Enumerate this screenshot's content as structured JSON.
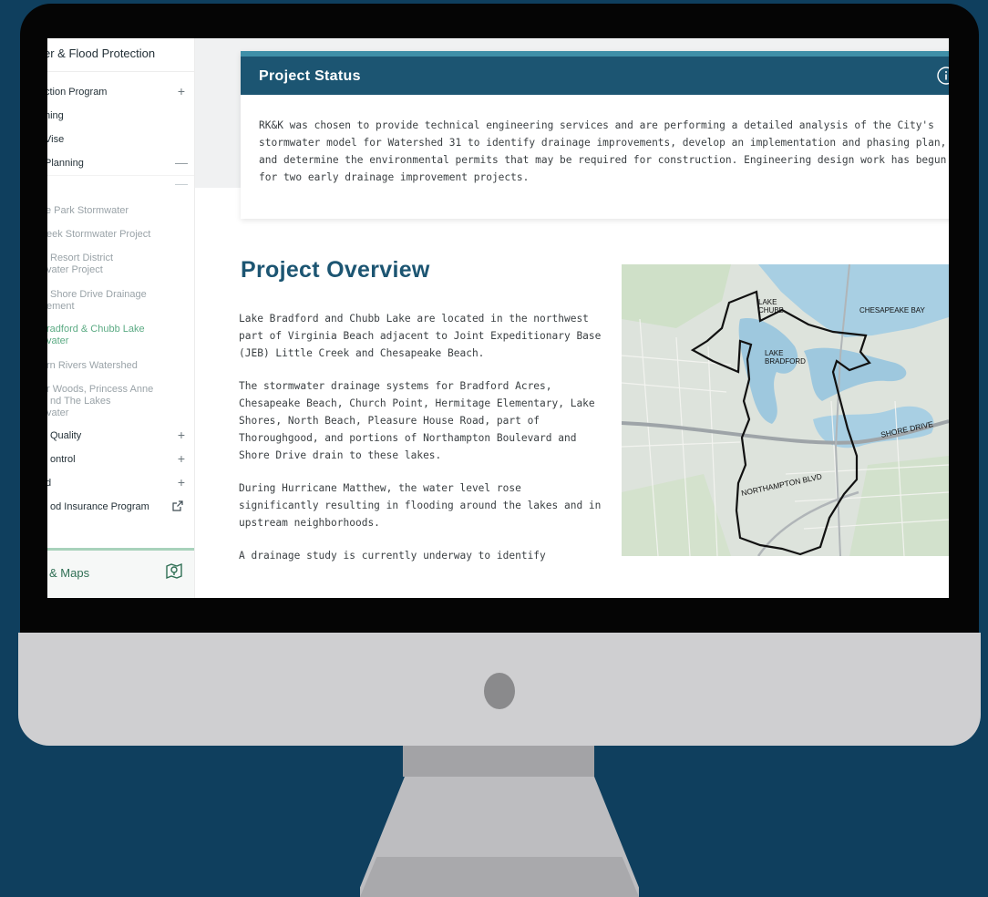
{
  "sidebar": {
    "title": "er & Flood Protection",
    "items": [
      {
        "label": "ction Program",
        "toggle": "+"
      },
      {
        "label": "ning"
      },
      {
        "label": "Vise"
      },
      {
        "label": "Planning",
        "toggle": "—"
      },
      {
        "label": "",
        "toggle": "—"
      },
      {
        "label": "e Park Stormwater"
      },
      {
        "label": "eek Stormwater Project"
      },
      {
        "label": "Resort District",
        "label2": "vater Project"
      },
      {
        "label": "Shore Drive Drainage",
        "label2": "ement"
      },
      {
        "label": "radford & Chubb Lake",
        "label2": "vater"
      },
      {
        "label": "rn Rivers Watershed"
      },
      {
        "label": "r Woods, Princess Anne",
        "label2": "nd The Lakes",
        "label3": "vater"
      },
      {
        "label": "Quality",
        "toggle": "+"
      },
      {
        "label": "ontrol",
        "toggle": "+"
      },
      {
        "label": "d",
        "toggle": "+"
      },
      {
        "label": "od Insurance Program"
      }
    ],
    "maps_label": "& Maps"
  },
  "status": {
    "title": "Project Status",
    "body": "RK&K was chosen to provide technical engineering services and are performing a detailed analysis of the City's stormwater model for Watershed 31 to identify drainage improvements, develop an implementation and phasing plan, and determine the environmental permits that may be required for construction. Engineering design work has begun for two early drainage improvement projects."
  },
  "overview": {
    "title": "Project Overview",
    "p1": "Lake Bradford and Chubb Lake are located in the northwest part of Virginia Beach adjacent to Joint Expeditionary Base (JEB) Little Creek and Chesapeake Beach.",
    "p2": "The stormwater drainage systems for Bradford Acres, Chesapeake Beach, Church Point, Hermitage Elementary, Lake Shores, North Beach, Pleasure House Road, part of Thoroughgood, and portions of Northampton Boulevard and Shore Drive drain to these lakes.",
    "p3": "During Hurricane Matthew, the water level rose significantly resulting in flooding around the lakes and in upstream neighborhoods.",
    "p4": "A drainage study is currently underway to identify"
  },
  "map": {
    "labels": {
      "lake_chubb_1": "LAKE",
      "lake_chubb_2": "CHUBB",
      "lake_bradford_1": "LAKE",
      "lake_bradford_2": "BRADFORD",
      "chesapeake_bay": "CHESAPEAKE BAY",
      "shore_drive": "SHORE DRIVE",
      "northampton": "NORTHAMPTON BLVD"
    }
  },
  "icons": {
    "info": "info-icon",
    "plus": "plus-icon",
    "minus": "minus-icon",
    "external": "external-link-icon",
    "map_pin": "map-pin-icon"
  },
  "colors": {
    "page_bg": "#0f3f5e",
    "header_blue": "#1c5572",
    "accent_green": "#5cab84"
  }
}
